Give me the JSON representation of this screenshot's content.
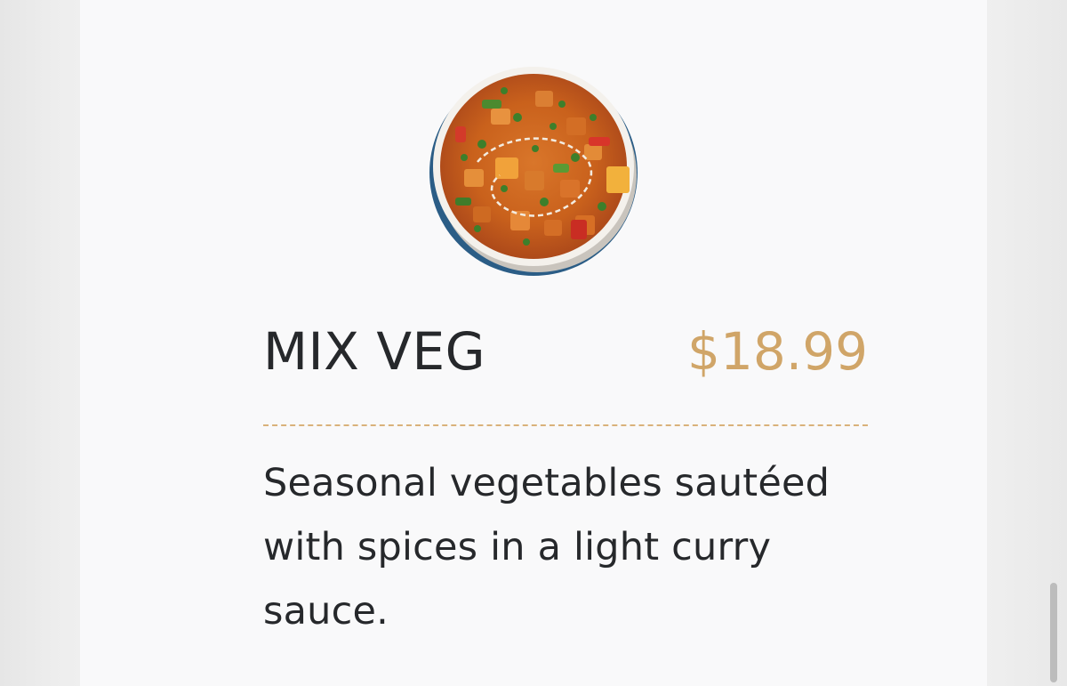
{
  "menu_item": {
    "name": "MIX VEG",
    "price": "$18.99",
    "description": "Seasonal vegetables sautéed with spices in a light curry sauce.",
    "image_icon": "curry-bowl-photo"
  },
  "colors": {
    "title": "#26282b",
    "price": "#d0a568",
    "divider": "#d9b27a",
    "card_background": "#f9f9fa"
  }
}
